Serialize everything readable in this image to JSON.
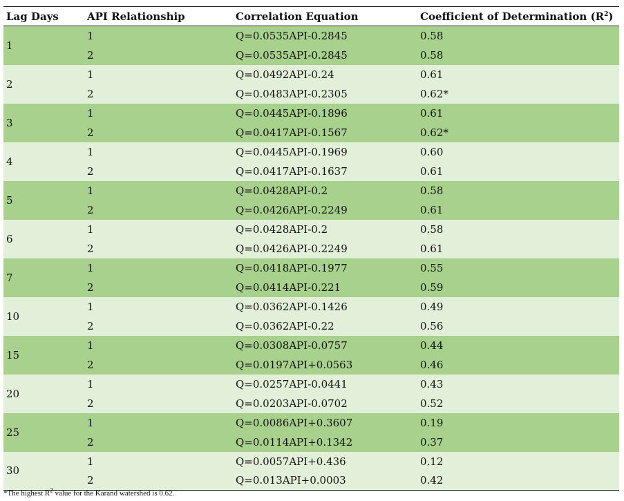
{
  "headers": {
    "lag": "Lag Days",
    "api": "API Relationship",
    "eq": "Correlation Equation",
    "r2_prefix": "Coefficient of Determination (R",
    "r2_sup": "2",
    "r2_suffix": ")"
  },
  "groups": [
    {
      "lag": "1",
      "rows": [
        {
          "api": "1",
          "eq": "Q=0.0535API-0.2845",
          "r2": "0.58"
        },
        {
          "api": "2",
          "eq": "Q=0.0535API-0.2845",
          "r2": "0.58"
        }
      ]
    },
    {
      "lag": "2",
      "rows": [
        {
          "api": "1",
          "eq": "Q=0.0492API-0.24",
          "r2": "0.61"
        },
        {
          "api": "2",
          "eq": "Q=0.0483API-0.2305",
          "r2": "0.62*"
        }
      ]
    },
    {
      "lag": "3",
      "rows": [
        {
          "api": "1",
          "eq": "Q=0.0445API-0.1896",
          "r2": "0.61"
        },
        {
          "api": "2",
          "eq": "Q=0.0417API-0.1567",
          "r2": "0.62*"
        }
      ]
    },
    {
      "lag": "4",
      "rows": [
        {
          "api": "1",
          "eq": "Q=0.0445API-0.1969",
          "r2": "0.60"
        },
        {
          "api": "2",
          "eq": "Q=0.0417API-0.1637",
          "r2": "0.61"
        }
      ]
    },
    {
      "lag": "5",
      "rows": [
        {
          "api": "1",
          "eq": "Q=0.0428API-0.2",
          "r2": "0.58"
        },
        {
          "api": "2",
          "eq": "Q=0.0426API-0.2249",
          "r2": "0.61"
        }
      ]
    },
    {
      "lag": "6",
      "rows": [
        {
          "api": "1",
          "eq": "Q=0.0428API-0.2",
          "r2": "0.58"
        },
        {
          "api": "2",
          "eq": "Q=0.0426API-0.2249",
          "r2": "0.61"
        }
      ]
    },
    {
      "lag": "7",
      "rows": [
        {
          "api": "1",
          "eq": "Q=0.0418API-0.1977",
          "r2": "0.55"
        },
        {
          "api": "2",
          "eq": "Q=0.0414API-0.221",
          "r2": "0.59"
        }
      ]
    },
    {
      "lag": "10",
      "rows": [
        {
          "api": "1",
          "eq": "Q=0.0362API-0.1426",
          "r2": "0.49"
        },
        {
          "api": "2",
          "eq": "Q=0.0362API-0.22",
          "r2": "0.56"
        }
      ]
    },
    {
      "lag": "15",
      "rows": [
        {
          "api": "1",
          "eq": "Q=0.0308API-0.0757",
          "r2": "0.44"
        },
        {
          "api": "2",
          "eq": "Q=0.0197API+0.0563",
          "r2": "0.46"
        }
      ]
    },
    {
      "lag": "20",
      "rows": [
        {
          "api": "1",
          "eq": "Q=0.0257API-0.0441",
          "r2": "0.43"
        },
        {
          "api": "2",
          "eq": "Q=0.0203API-0.0702",
          "r2": "0.52"
        }
      ]
    },
    {
      "lag": "25",
      "rows": [
        {
          "api": "1",
          "eq": "Q=0.0086API+0.3607",
          "r2": "0.19"
        },
        {
          "api": "2",
          "eq": "Q=0.0114API+0.1342",
          "r2": "0.37"
        }
      ]
    },
    {
      "lag": "30",
      "rows": [
        {
          "api": "1",
          "eq": "Q=0.0057API+0.436",
          "r2": "0.12"
        },
        {
          "api": "2",
          "eq": "Q=0.013API+0.0003",
          "r2": "0.42"
        }
      ]
    }
  ],
  "footnote": {
    "prefix": "*The highest R",
    "sup": "2",
    "suffix": " value for the Karand watershed is 0.62."
  },
  "colors": {
    "band_dark": "#a9d18e",
    "band_light": "#e2efd9"
  }
}
